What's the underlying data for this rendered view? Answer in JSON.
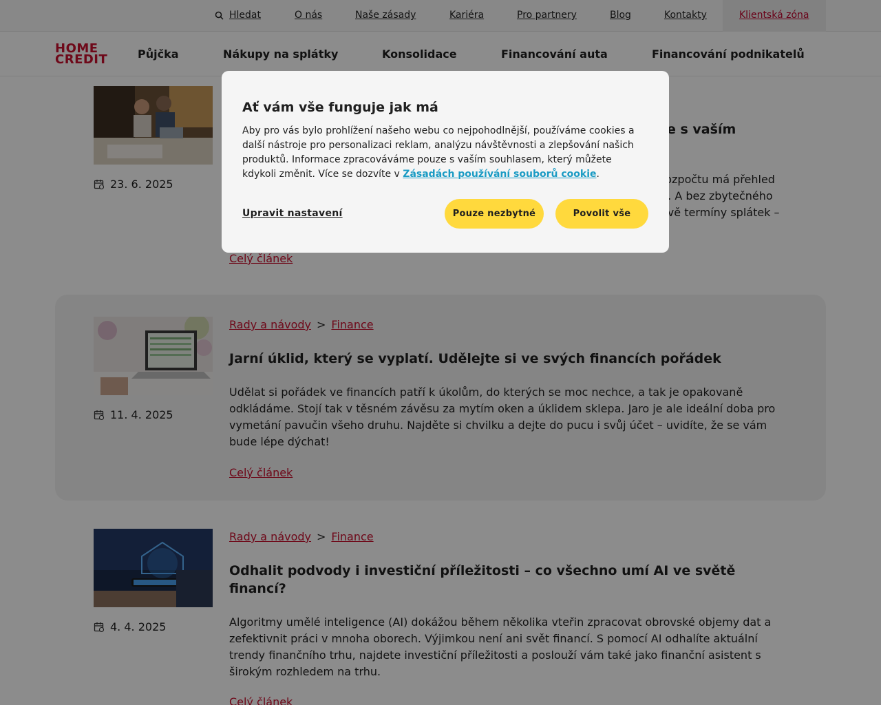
{
  "topbar": {
    "search": "Hledat",
    "links": [
      "O nás",
      "Naše zásady",
      "Kariéra",
      "Pro partnery",
      "Blog",
      "Kontakty"
    ],
    "client_zone": "Klientská zóna"
  },
  "logo": {
    "line1": "HOME",
    "line2": "CREDIT"
  },
  "mainnav": [
    "Půjčka",
    "Nákupy na splátky",
    "Konsolidace",
    "Financování auta",
    "Financování podnikatelů"
  ],
  "articles": [
    {
      "date": "23. 6. 2025",
      "title_visible": "e s vaším",
      "perex_visible": [
        "rozpočtu má přehled",
        "u. A bez zbytečného",
        "avě termíny splátek –"
      ],
      "more": "Celý článek"
    },
    {
      "date": "11. 4. 2025",
      "crumb1": "Rady a návody",
      "crumb2": "Finance",
      "title": "Jarní úklid, který se vyplatí. Udělejte si ve svých financích pořádek",
      "perex": "Udělat si pořádek ve financích patří k úkolům, do kterých se moc nechce, a tak je opakovaně odkládáme. Stojí tak v těsném závěsu za mytím oken a úklidem sklepa. Jaro je ale ideální doba pro vymetání pavučin všeho druhu. Najděte si chvilku a dejte do pucu i svůj účet – uvidíte, že se vám bude lépe dýchat!",
      "more": "Celý článek"
    },
    {
      "date": "4. 4. 2025",
      "crumb1": "Rady a návody",
      "crumb2": "Finance",
      "title": "Odhalit podvody i investiční příležitosti – co všechno umí AI ve světě financí?",
      "perex": "Algoritmy umělé inteligence (AI) dokážou během několika vteřin zpracovat obrovské objemy dat a zefektivnit práci v mnoha oborech. Výjimkou není ani svět financí. S pomocí AI odhalíte aktuální trendy finančního trhu, najdete investiční příležitosti a poslouží vám také jako finanční asistent s širokým rozhledem na trhu.",
      "more": "Celý článek"
    }
  ],
  "cookie": {
    "title": "Ať vám vše funguje jak má",
    "text": "Aby pro vás bylo prohlížení našeho webu co nejpohodlnější, používáme cookies a další nástroje pro personalizaci reklam, analýzu návštěvnosti a zlepšování našich produktů. Informace zpracováváme pouze s vaším souhlasem, který můžete kdykoli změnit. Více se dozvíte v ",
    "link": "Zásadách používání souborů cookie",
    "text_end": ".",
    "settings": "Upravit nastavení",
    "btn_necessary": "Pouze nezbytné",
    "btn_all": "Povolit vše"
  },
  "colors": {
    "brand": "#c8102e",
    "button": "#ffd93d",
    "link": "#1a9bc4"
  }
}
